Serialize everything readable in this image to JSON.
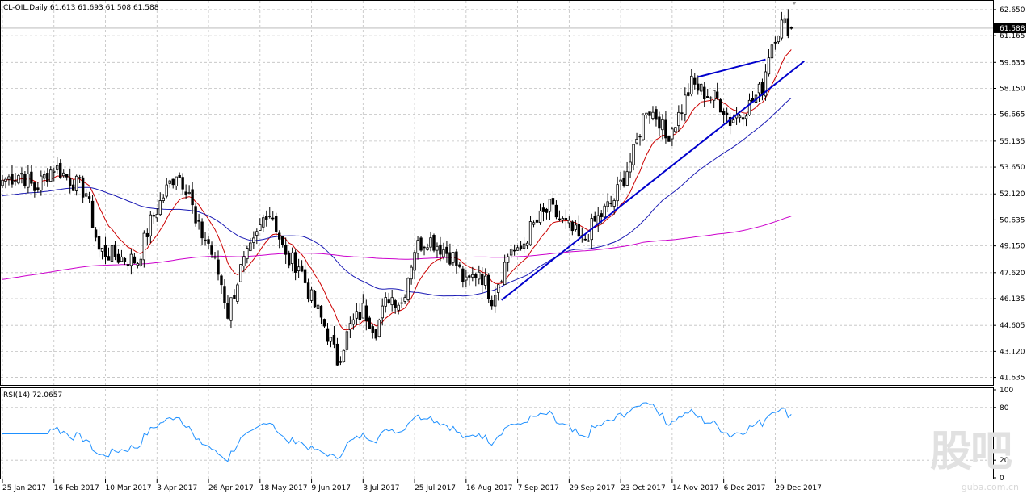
{
  "header": {
    "main_label": "CL-OIL,Daily  61.613 61.693 61.508 61.588",
    "rsi_label": "RSI(14) 72.0657"
  },
  "watermark": {
    "big_text": "股吧",
    "site_text": "guba.com.cn"
  },
  "chart_data": [
    {
      "type": "candlestick",
      "symbol": "CL-OIL",
      "timeframe": "Daily",
      "ohlc_last": {
        "open": 61.613,
        "high": 61.693,
        "low": 61.508,
        "close": 61.588
      },
      "current_price_label": "61.588",
      "ylim": [
        41.2,
        63.2
      ],
      "y_ticks": [
        62.65,
        61.165,
        59.635,
        58.15,
        56.665,
        55.135,
        53.65,
        52.12,
        50.635,
        49.15,
        47.62,
        46.135,
        44.605,
        43.12,
        41.635
      ],
      "y_tick_labels": [
        "62.650",
        "61.165",
        "59.635",
        "58.150",
        "56.665",
        "55.135",
        "53.650",
        "52.120",
        "50.635",
        "49.150",
        "47.620",
        "46.135",
        "44.605",
        "43.120",
        "41.635"
      ],
      "x_tick_labels": [
        "25 Jan 2017",
        "16 Feb 2017",
        "10 Mar 2017",
        "3 Apr 2017",
        "26 Apr 2017",
        "18 May 2017",
        "9 Jun 2017",
        "3 Jul 2017",
        "25 Jul 2017",
        "16 Aug 2017",
        "7 Sep 2017",
        "29 Sep 2017",
        "23 Oct 2017",
        "14 Nov 2017",
        "6 Dec 2017",
        "29 Dec 2017"
      ],
      "x_tick_positions": [
        0,
        16,
        32,
        48,
        64,
        80,
        96,
        112,
        128,
        144,
        160,
        176,
        192,
        208,
        224,
        240
      ],
      "bar_count": 246,
      "close_keypoints": [
        [
          0,
          52.9
        ],
        [
          6,
          53.3
        ],
        [
          10,
          52.4
        ],
        [
          16,
          53.7
        ],
        [
          20,
          53.1
        ],
        [
          26,
          52.2
        ],
        [
          30,
          48.9
        ],
        [
          36,
          48.5
        ],
        [
          42,
          48.3
        ],
        [
          46,
          50.5
        ],
        [
          50,
          52.0
        ],
        [
          54,
          53.4
        ],
        [
          58,
          52.3
        ],
        [
          60,
          50.3
        ],
        [
          64,
          49.3
        ],
        [
          68,
          47.0
        ],
        [
          70,
          45.3
        ],
        [
          74,
          47.8
        ],
        [
          78,
          49.2
        ],
        [
          82,
          51.2
        ],
        [
          84,
          50.9
        ],
        [
          88,
          48.4
        ],
        [
          92,
          48.1
        ],
        [
          96,
          46.1
        ],
        [
          100,
          44.6
        ],
        [
          104,
          42.6
        ],
        [
          108,
          44.5
        ],
        [
          112,
          45.5
        ],
        [
          116,
          44.4
        ],
        [
          120,
          46.3
        ],
        [
          124,
          45.9
        ],
        [
          128,
          49.0
        ],
        [
          132,
          49.6
        ],
        [
          136,
          49.1
        ],
        [
          140,
          48.5
        ],
        [
          144,
          46.9
        ],
        [
          148,
          47.8
        ],
        [
          152,
          46.2
        ],
        [
          156,
          48.1
        ],
        [
          158,
          49.1
        ],
        [
          160,
          48.6
        ],
        [
          164,
          50.1
        ],
        [
          170,
          51.3
        ],
        [
          174,
          50.5
        ],
        [
          178,
          49.8
        ],
        [
          180,
          49.3
        ],
        [
          184,
          50.5
        ],
        [
          190,
          51.8
        ],
        [
          196,
          54.4
        ],
        [
          200,
          57.1
        ],
        [
          204,
          56.4
        ],
        [
          206,
          55.3
        ],
        [
          210,
          56.6
        ],
        [
          214,
          58.4
        ],
        [
          218,
          57.9
        ],
        [
          222,
          57.5
        ],
        [
          224,
          57.0
        ],
        [
          226,
          56.3
        ],
        [
          232,
          57.2
        ],
        [
          236,
          58.2
        ],
        [
          238,
          60.2
        ],
        [
          240,
          61.3
        ],
        [
          242,
          61.8
        ],
        [
          244,
          61.7
        ],
        [
          245,
          61.588
        ]
      ],
      "series": [
        {
          "name": "",
          "kind": "moving-average",
          "color": "#cc0000"
        },
        {
          "name": "",
          "kind": "moving-average",
          "color": "#1a1ab4"
        },
        {
          "name": "",
          "kind": "moving-average",
          "color": "#cc00cc"
        }
      ],
      "trendlines": [
        {
          "color": "#0000cc",
          "points": [
            [
              155,
              46.05
            ],
            [
              249,
              59.7
            ]
          ]
        },
        {
          "color": "#0000cc",
          "points": [
            [
              216,
              58.8
            ],
            [
              237,
              59.8
            ]
          ]
        }
      ]
    },
    {
      "type": "line",
      "name": "RSI(14)",
      "current_value": 72.0657,
      "ylim": [
        0,
        100
      ],
      "y_ticks": [
        100,
        80,
        20,
        0
      ],
      "y_tick_labels": [
        "100",
        "80",
        "20",
        "0"
      ],
      "color": "#1e90ff"
    }
  ],
  "colors": {
    "bullish_candle": "#ffffff",
    "bearish_candle": "#000000",
    "grid": "#c0c0c0",
    "price_line": "#b0b0b0"
  }
}
